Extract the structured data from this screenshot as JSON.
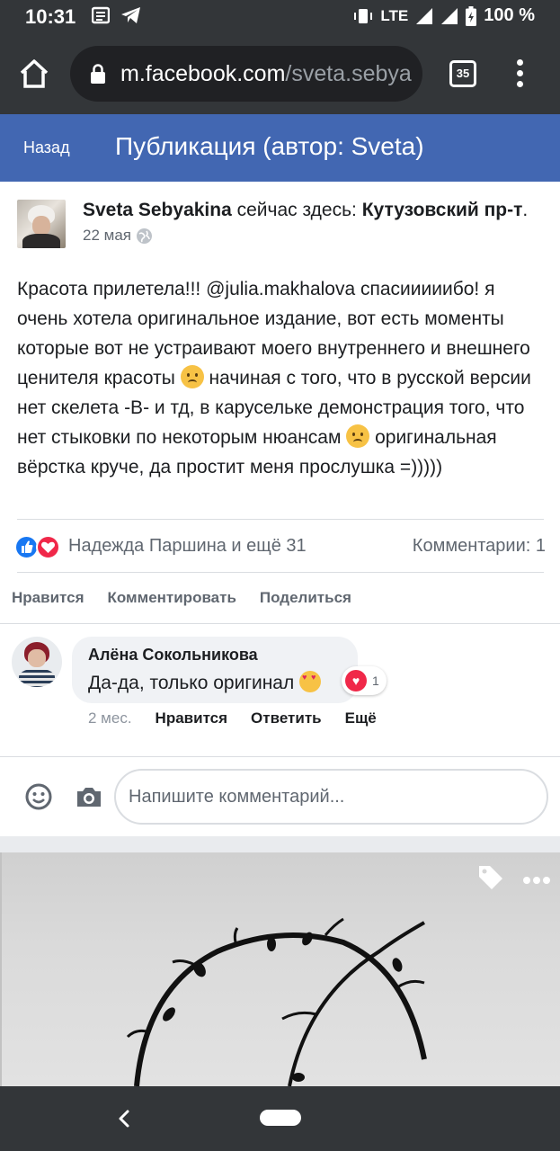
{
  "status_bar": {
    "time": "10:31",
    "network": "LTE",
    "battery": "100 %"
  },
  "browser": {
    "url_host": "m.facebook.com",
    "url_path": "/sveta.sebya",
    "tab_count": "35"
  },
  "fb_header": {
    "back_label": "Назад",
    "title": "Публикация (автор: Sveta)"
  },
  "post": {
    "author": "Sveta Sebyakina",
    "checkin_prefix": " сейчас здесь: ",
    "place": "Кутузовский пр-т",
    "place_suffix": ".",
    "date": "22 мая",
    "text_part1": "Красота прилетела!!! @julia.makhalova спасииииибо! я очень хотела оригинальное издание, вот есть моменты которые вот не устраивают моего внутреннего и внешнего ценителя красоты ",
    "text_part2": " начиная с того, что в русской версии нет скелета -В- и тд, в каруселькe демонстрация того, что нет стыковки по некоторым нюансам ",
    "text_part3": " оригинальная вёрстка круче, да простит меня прослушка =)))))",
    "reactors": "Надежда Паршина и ещё 31",
    "comments_count": "Комментарии: 1"
  },
  "actions": {
    "like": "Нравится",
    "comment": "Комментировать",
    "share": "Поделиться"
  },
  "comment": {
    "author": "Алёна Сокольникова",
    "text": "Да-да, только оригинал ",
    "reaction_count": "1",
    "time": "2 мес.",
    "like": "Нравится",
    "reply": "Ответить",
    "more": "Ещё"
  },
  "composer": {
    "placeholder": "Напишите комментарий..."
  },
  "colors": {
    "fb_blue": "#4267b2",
    "chrome_dark": "#333639",
    "like_blue": "#1877f2",
    "love_red": "#f02849"
  }
}
